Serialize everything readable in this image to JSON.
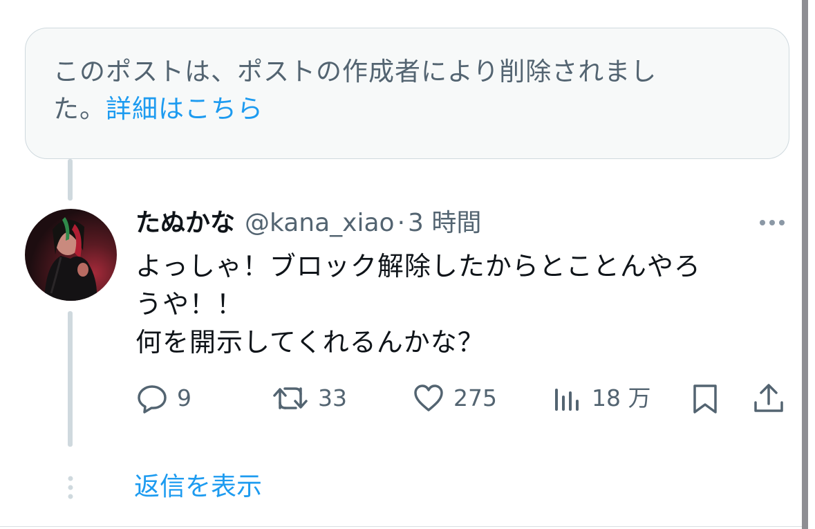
{
  "notice": {
    "line1": "このポストは、ポストの作成者により削除されまし",
    "line2": "た。",
    "link": "詳細はこちら"
  },
  "tweet": {
    "display_name": "たぬかな",
    "handle": "@kana_xiao",
    "separator": "·",
    "timestamp": "3 時間",
    "text_lines": [
      "よっしゃ！ブロック解除したからとことんやろ",
      "うや！！",
      "何を開示してくれるんかな？"
    ],
    "actions": {
      "reply": {
        "icon": "reply-icon",
        "count": "9"
      },
      "retweet": {
        "icon": "retweet-icon",
        "count": "33"
      },
      "like": {
        "icon": "heart-icon",
        "count": "275"
      },
      "views": {
        "icon": "views-icon",
        "count": "18 万"
      },
      "bookmark": {
        "icon": "bookmark-icon"
      },
      "share": {
        "icon": "share-icon"
      }
    }
  },
  "show_replies": "返信を表示",
  "colors": {
    "text": "#0f1419",
    "secondary": "#536471",
    "link": "#1d9bf0",
    "notice_bg": "#f7f9f9",
    "border": "#cfd9de"
  }
}
